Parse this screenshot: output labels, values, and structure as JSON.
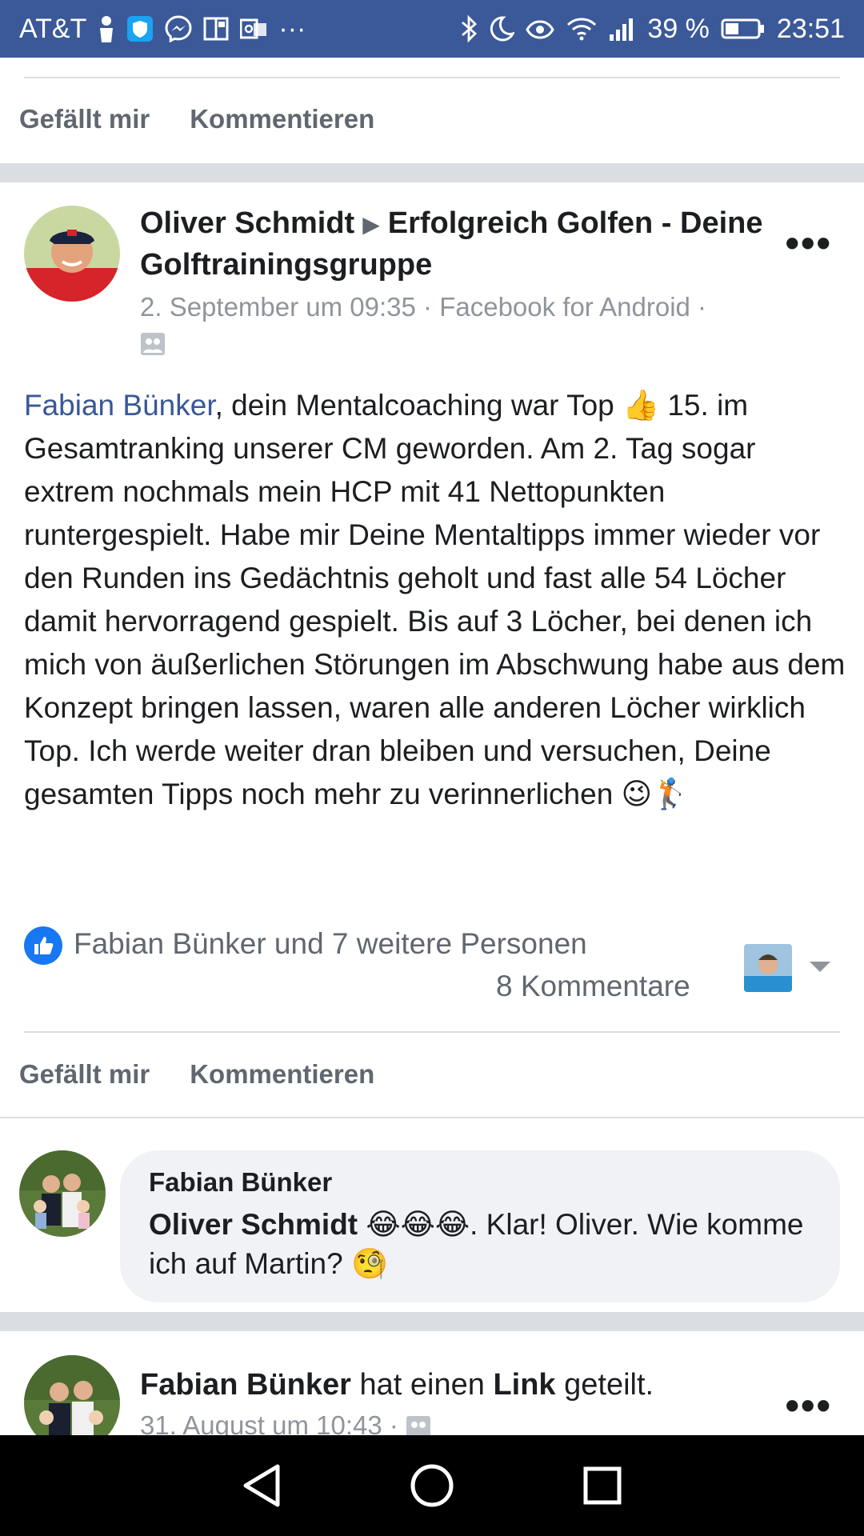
{
  "status_bar": {
    "carrier": "AT&T",
    "battery_percent": "39 %",
    "time": "23:51",
    "icons_left": [
      "person-icon",
      "shield-icon",
      "messenger-icon",
      "news-icon",
      "outlook-icon",
      "more-dots-icon"
    ],
    "icons_right": [
      "bluetooth-icon",
      "moon-icon",
      "eye-icon",
      "wifi-icon",
      "signal-icon",
      "battery-icon"
    ],
    "overflow": "···"
  },
  "prev_post_actions": {
    "like": "Gefällt mir",
    "comment": "Kommentieren"
  },
  "post": {
    "author": "Oliver Schmidt",
    "group": "Erfolgreich Golfen - Deine Golftrainingsgruppe",
    "meta": "2. September um 09:35 · Facebook for Android ·",
    "body_mention": "Fabian Bünker",
    "body_text": ", dein Mentalcoaching war Top 👍 15. im Gesamtranking unserer CM geworden. Am 2. Tag sogar extrem nochmals mein HCP mit 41 Nettopunkten runtergespielt. Habe mir Deine Mentaltipps immer wieder vor den Runden ins Gedächtnis geholt und fast alle 54 Löcher damit hervorragend gespielt. Bis auf 3 Löcher, bei denen ich mich von äußerlichen Störungen im Abschwung habe aus dem Konzept bringen lassen, waren alle anderen Löcher wirklich Top. Ich werde weiter dran bleiben und versuchen, Deine gesamten Tipps noch mehr zu verinnerlichen 😉🏌️",
    "reactions_text": "Fabian Bünker und 7 weitere Personen",
    "comments_count": "8 Kommentare",
    "actions": {
      "like": "Gefällt mir",
      "comment": "Kommentieren"
    },
    "more": "•••"
  },
  "comment": {
    "author": "Fabian Bünker",
    "mention": "Oliver Schmidt",
    "text": " 😂😂😂. Klar! Oliver. Wie komme ich auf Martin? 🧐"
  },
  "next_post": {
    "author": "Fabian Bünker",
    "action_pre": " hat einen ",
    "action_bold": "Link",
    "action_post": " geteilt.",
    "meta": "31. August um 10:43 ·",
    "more": "•••"
  },
  "colors": {
    "status_bar": "#3b5998",
    "link": "#385898",
    "like_blue": "#1877f2",
    "muted": "#606770",
    "nav_bar": "#000000"
  }
}
